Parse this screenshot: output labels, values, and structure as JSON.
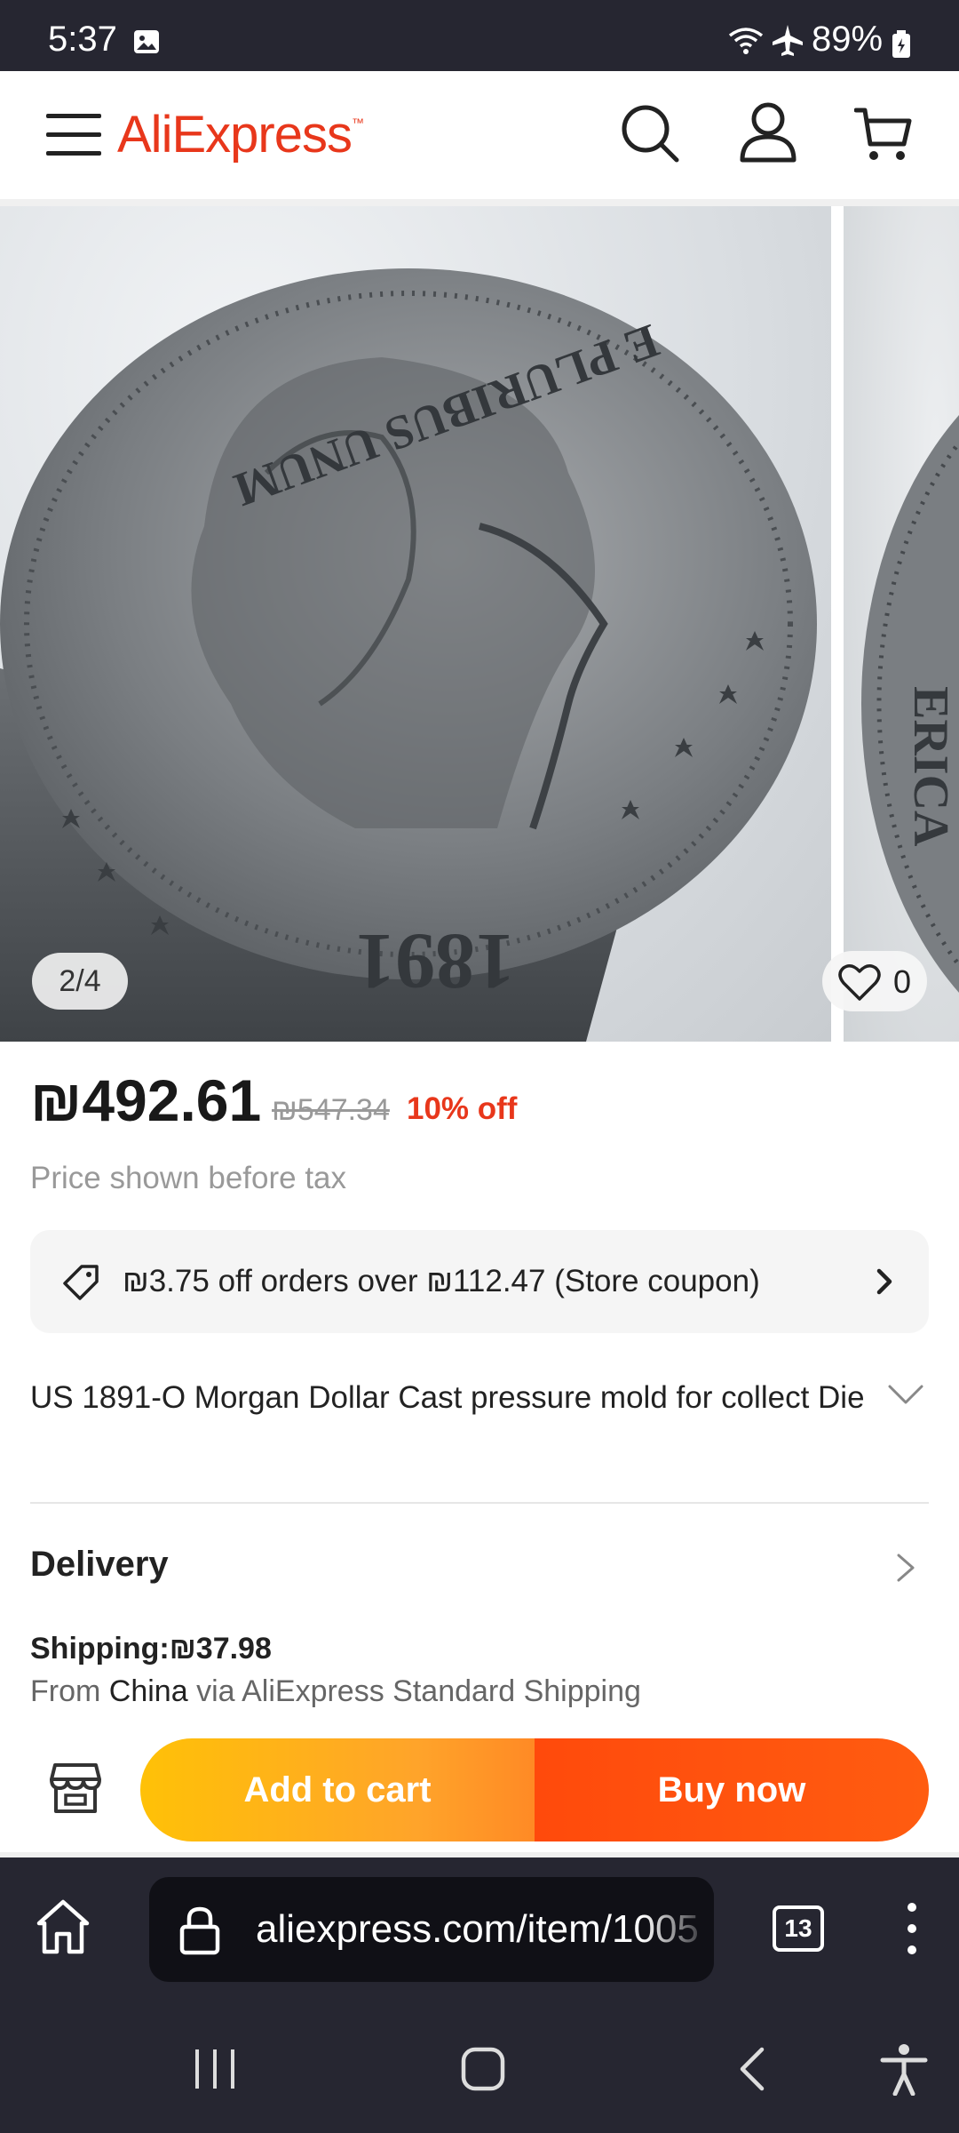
{
  "status_bar": {
    "time": "5:37",
    "battery": "89%"
  },
  "header": {
    "logo": "AliExpress",
    "logo_tm": "™"
  },
  "gallery": {
    "counter": "2/4",
    "wishlist_count": "0",
    "image_text_primary": "E PLURIBUS UNUM",
    "image_text_year": "1891",
    "image_text_partial": "ERICA"
  },
  "price": {
    "current": "₪492.61",
    "original": "₪547.34",
    "discount": "10% off",
    "tax_note": "Price shown before tax"
  },
  "coupon": {
    "text": "₪3.75 off orders over ₪112.47 (Store coupon)"
  },
  "product": {
    "title": "US 1891-O Morgan Dollar Cast pressure mold for collect Die"
  },
  "delivery": {
    "title": "Delivery",
    "shipping": "Shipping:₪37.98",
    "from_prefix": "From",
    "from_country": "China",
    "via": "via AliExpress Standard Shipping"
  },
  "actions": {
    "add_to_cart": "Add to cart",
    "buy_now": "Buy now"
  },
  "browser": {
    "url": "aliexpress.com/item/1005",
    "tab_count": "13"
  },
  "colors": {
    "brand": "#e8371b",
    "add_to_cart_start": "#ffc107",
    "buy_now": "#ff4a0c",
    "system_bar": "#262631"
  },
  "icons": [
    "gallery-icon",
    "wifi-icon",
    "airplane-icon",
    "battery-icon",
    "menu-icon",
    "search-icon",
    "account-icon",
    "cart-icon",
    "heart-icon",
    "tag-icon",
    "chevron-right-icon",
    "chevron-down-icon",
    "store-icon",
    "home-icon",
    "lock-icon",
    "more-icon",
    "recent-apps-icon",
    "nav-home-icon",
    "back-icon",
    "accessibility-icon"
  ]
}
